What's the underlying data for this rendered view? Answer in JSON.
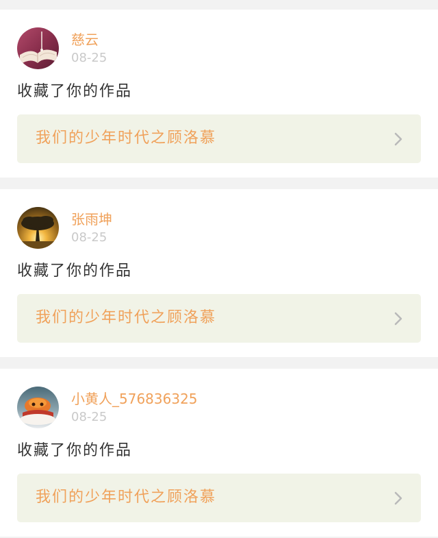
{
  "notifications": [
    {
      "username": "慈云",
      "date": "08-25",
      "action": "收藏了你的作品",
      "work_title": "我们的少年时代之顾洛慕",
      "avatar_icon": "book-pages-avatar"
    },
    {
      "username": "张雨坤",
      "date": "08-25",
      "action": "收藏了你的作品",
      "work_title": "我们的少年时代之顾洛慕",
      "avatar_icon": "tree-sunset-avatar"
    },
    {
      "username": "小黄人_576836325",
      "date": "08-25",
      "action": "收藏了你的作品",
      "work_title": "我们的少年时代之顾洛慕",
      "avatar_icon": "orange-creature-avatar"
    }
  ],
  "colors": {
    "accent": "#f0a15a",
    "date": "#c9c9c9",
    "text": "#333333",
    "link_bg": "#f1f3e7",
    "page_bg": "#f2f2f2"
  }
}
